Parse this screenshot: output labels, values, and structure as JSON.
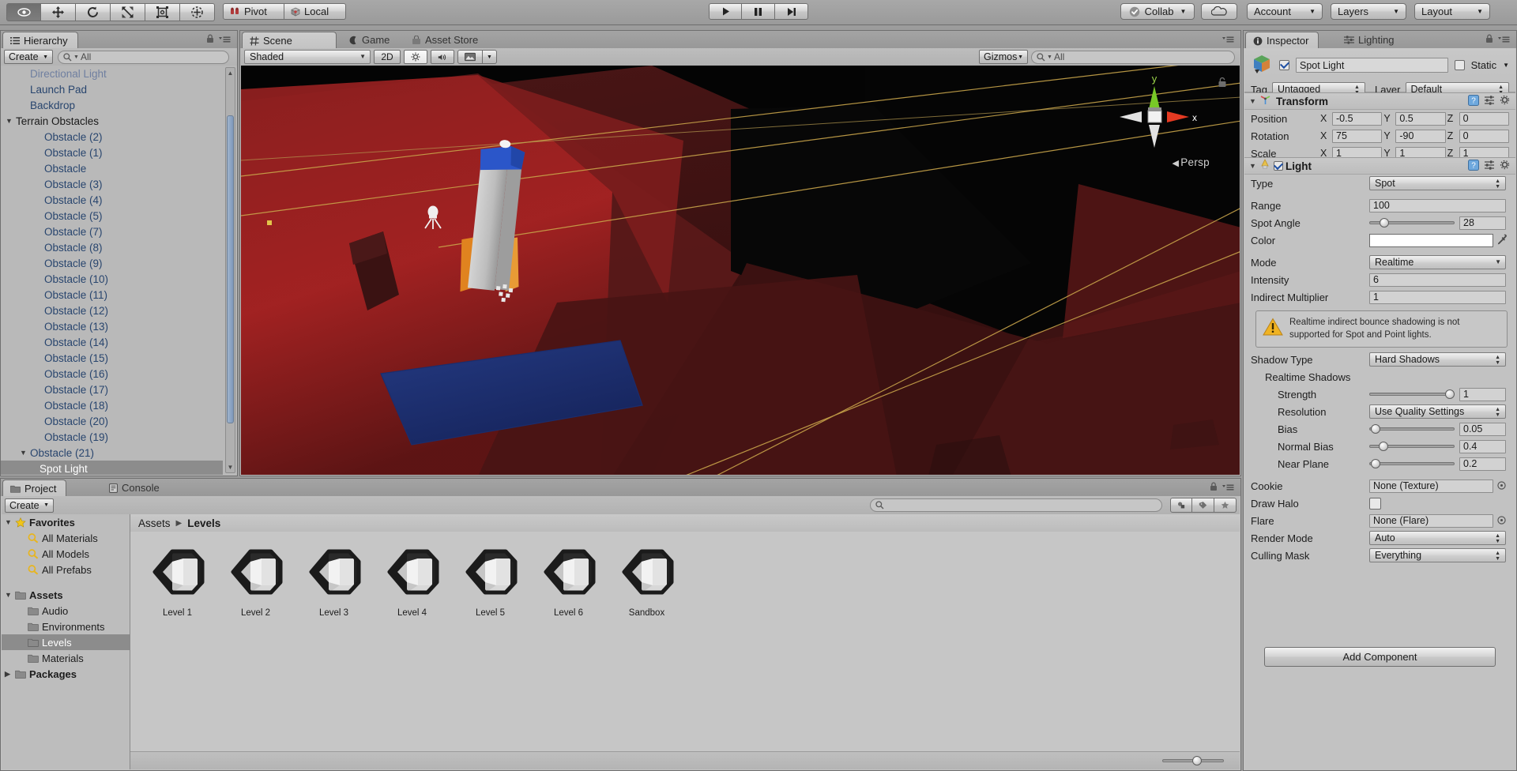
{
  "toolbar": {
    "tools": [
      {
        "name": "hand-tool",
        "label": "Hand",
        "active": true
      },
      {
        "name": "move-tool",
        "label": "Move",
        "active": false
      },
      {
        "name": "rotate-tool",
        "label": "Rotate",
        "active": false
      },
      {
        "name": "scale-tool",
        "label": "Scale",
        "active": false
      },
      {
        "name": "rect-tool",
        "label": "Rect",
        "active": false
      },
      {
        "name": "transform-tool",
        "label": "Transform",
        "active": false
      }
    ],
    "pivot_label": "Pivot",
    "local_label": "Local",
    "play_label": "Play",
    "pause_label": "Pause",
    "step_label": "Step",
    "collab_label": "Collab",
    "cloud_label": "Cloud",
    "account_label": "Account",
    "layers_label": "Layers",
    "layout_label": "Layout"
  },
  "hierarchy": {
    "tab_label": "Hierarchy",
    "create_label": "Create",
    "search_placeholder": "All",
    "items": [
      {
        "label": "Directional Light",
        "indent": 1,
        "style": "dim",
        "foldout": ""
      },
      {
        "label": "Launch Pad",
        "indent": 1,
        "style": "blue",
        "foldout": ""
      },
      {
        "label": "Backdrop",
        "indent": 1,
        "style": "blue",
        "foldout": ""
      },
      {
        "label": "Terrain Obstacles",
        "indent": 0,
        "style": "black",
        "foldout": "▼"
      },
      {
        "label": "Obstacle (2)",
        "indent": 2,
        "style": "blue",
        "foldout": ""
      },
      {
        "label": "Obstacle (1)",
        "indent": 2,
        "style": "blue",
        "foldout": ""
      },
      {
        "label": "Obstacle",
        "indent": 2,
        "style": "blue",
        "foldout": ""
      },
      {
        "label": "Obstacle (3)",
        "indent": 2,
        "style": "blue",
        "foldout": ""
      },
      {
        "label": "Obstacle (4)",
        "indent": 2,
        "style": "blue",
        "foldout": ""
      },
      {
        "label": "Obstacle (5)",
        "indent": 2,
        "style": "blue",
        "foldout": ""
      },
      {
        "label": "Obstacle (7)",
        "indent": 2,
        "style": "blue",
        "foldout": ""
      },
      {
        "label": "Obstacle (8)",
        "indent": 2,
        "style": "blue",
        "foldout": ""
      },
      {
        "label": "Obstacle (9)",
        "indent": 2,
        "style": "blue",
        "foldout": ""
      },
      {
        "label": "Obstacle (10)",
        "indent": 2,
        "style": "blue",
        "foldout": ""
      },
      {
        "label": "Obstacle (11)",
        "indent": 2,
        "style": "blue",
        "foldout": ""
      },
      {
        "label": "Obstacle (12)",
        "indent": 2,
        "style": "blue",
        "foldout": ""
      },
      {
        "label": "Obstacle (13)",
        "indent": 2,
        "style": "blue",
        "foldout": ""
      },
      {
        "label": "Obstacle (14)",
        "indent": 2,
        "style": "blue",
        "foldout": ""
      },
      {
        "label": "Obstacle (15)",
        "indent": 2,
        "style": "blue",
        "foldout": ""
      },
      {
        "label": "Obstacle (16)",
        "indent": 2,
        "style": "blue",
        "foldout": ""
      },
      {
        "label": "Obstacle (17)",
        "indent": 2,
        "style": "blue",
        "foldout": ""
      },
      {
        "label": "Obstacle (18)",
        "indent": 2,
        "style": "blue",
        "foldout": ""
      },
      {
        "label": "Obstacle (20)",
        "indent": 2,
        "style": "blue",
        "foldout": ""
      },
      {
        "label": "Obstacle (19)",
        "indent": 2,
        "style": "blue",
        "foldout": ""
      },
      {
        "label": "Obstacle (21)",
        "indent": 1,
        "style": "blue",
        "foldout": "▼"
      },
      {
        "label": "Spot Light",
        "indent": 2,
        "style": "selected",
        "foldout": ""
      }
    ]
  },
  "scene": {
    "tabs": [
      {
        "label": "Scene",
        "icon": "grid-icon",
        "active": true
      },
      {
        "label": "Game",
        "icon": "gamepad-icon",
        "active": false
      },
      {
        "label": "Asset Store",
        "icon": "store-icon",
        "active": false
      }
    ],
    "draw_mode": "Shaded",
    "twod_label": "2D",
    "gizmos_label": "Gizmos",
    "search_placeholder": "All",
    "axis_y": "y",
    "axis_x": "x",
    "persp_label": "Persp"
  },
  "inspector": {
    "tabs": [
      {
        "label": "Inspector",
        "icon": "info-icon",
        "active": true
      },
      {
        "label": "Lighting",
        "icon": "sliders-icon",
        "active": false
      }
    ],
    "object_enabled": true,
    "object_name": "Spot Light",
    "static_label": "Static",
    "static_checked": false,
    "tag_label": "Tag",
    "tag_value": "Untagged",
    "layer_label": "Layer",
    "layer_value": "Default",
    "transform": {
      "title": "Transform",
      "rows": [
        {
          "label": "Position",
          "x": "-0.5",
          "y": "0.5",
          "z": "0"
        },
        {
          "label": "Rotation",
          "x": "75",
          "y": "-90",
          "z": "0"
        },
        {
          "label": "Scale",
          "x": "1",
          "y": "1",
          "z": "1"
        }
      ]
    },
    "light": {
      "title": "Light",
      "enabled": true,
      "type_label": "Type",
      "type_value": "Spot",
      "range_label": "Range",
      "range_value": "100",
      "spot_angle_label": "Spot Angle",
      "spot_angle_value": "28",
      "spot_angle_pct": 14,
      "color_label": "Color",
      "color_value": "#ffffff",
      "mode_label": "Mode",
      "mode_value": "Realtime",
      "intensity_label": "Intensity",
      "intensity_value": "6",
      "indirect_label": "Indirect Multiplier",
      "indirect_value": "1",
      "warning_text": "Realtime indirect bounce shadowing is not supported for Spot and Point lights.",
      "shadow_type_label": "Shadow Type",
      "shadow_type_value": "Hard Shadows",
      "realtime_shadows_label": "Realtime Shadows",
      "strength_label": "Strength",
      "strength_value": "1",
      "strength_pct": 100,
      "resolution_label": "Resolution",
      "resolution_value": "Use Quality Settings",
      "bias_label": "Bias",
      "bias_value": "0.05",
      "bias_pct": 2,
      "normal_bias_label": "Normal Bias",
      "normal_bias_value": "0.4",
      "normal_bias_pct": 12,
      "near_plane_label": "Near Plane",
      "near_plane_value": "0.2",
      "near_plane_pct": 2,
      "cookie_label": "Cookie",
      "cookie_value": "None (Texture)",
      "draw_halo_label": "Draw Halo",
      "draw_halo_checked": false,
      "flare_label": "Flare",
      "flare_value": "None (Flare)",
      "render_mode_label": "Render Mode",
      "render_mode_value": "Auto",
      "culling_mask_label": "Culling Mask",
      "culling_mask_value": "Everything"
    },
    "add_component_label": "Add Component"
  },
  "project": {
    "tabs": [
      {
        "label": "Project",
        "icon": "folder-icon",
        "active": true
      },
      {
        "label": "Console",
        "icon": "console-icon",
        "active": false
      }
    ],
    "create_label": "Create",
    "search_placeholder": "",
    "tree": [
      {
        "label": "Favorites",
        "icon": "star-icon",
        "indent": 0,
        "foldout": "▼",
        "bold": true,
        "sel": false
      },
      {
        "label": "All Materials",
        "icon": "search-icon",
        "indent": 1,
        "foldout": "",
        "bold": false,
        "sel": false
      },
      {
        "label": "All Models",
        "icon": "search-icon",
        "indent": 1,
        "foldout": "",
        "bold": false,
        "sel": false
      },
      {
        "label": "All Prefabs",
        "icon": "search-icon",
        "indent": 1,
        "foldout": "",
        "bold": false,
        "sel": false
      },
      {
        "label": "",
        "icon": "",
        "indent": 0,
        "foldout": "",
        "bold": false,
        "sel": false
      },
      {
        "label": "Assets",
        "icon": "folder-icon",
        "indent": 0,
        "foldout": "▼",
        "bold": true,
        "sel": false
      },
      {
        "label": "Audio",
        "icon": "folder-icon",
        "indent": 1,
        "foldout": "",
        "bold": false,
        "sel": false
      },
      {
        "label": "Environments",
        "icon": "folder-icon",
        "indent": 1,
        "foldout": "",
        "bold": false,
        "sel": false
      },
      {
        "label": "Levels",
        "icon": "folder-icon",
        "indent": 1,
        "foldout": "",
        "bold": false,
        "sel": true
      },
      {
        "label": "Materials",
        "icon": "folder-icon",
        "indent": 1,
        "foldout": "",
        "bold": false,
        "sel": false
      },
      {
        "label": "Packages",
        "icon": "folder-icon",
        "indent": 0,
        "foldout": "▶",
        "bold": true,
        "sel": false
      }
    ],
    "breadcrumb": [
      "Assets",
      "Levels"
    ],
    "assets": [
      {
        "label": "Level 1",
        "icon": "unity-scene-icon"
      },
      {
        "label": "Level 2",
        "icon": "unity-scene-icon"
      },
      {
        "label": "Level 3",
        "icon": "unity-scene-icon"
      },
      {
        "label": "Level 4",
        "icon": "unity-scene-icon"
      },
      {
        "label": "Level 5",
        "icon": "unity-scene-icon"
      },
      {
        "label": "Level 6",
        "icon": "unity-scene-icon"
      },
      {
        "label": "Sandbox",
        "icon": "unity-scene-icon"
      }
    ],
    "zoom_pct": 58
  },
  "colors": {
    "hierarchy_blue": "#28456e",
    "selection_gray": "#8c8c8c",
    "panel_bg": "#c2c2c2",
    "chrome_bg": "#9c9c9c",
    "warning_yellow": "#e8b51e"
  }
}
